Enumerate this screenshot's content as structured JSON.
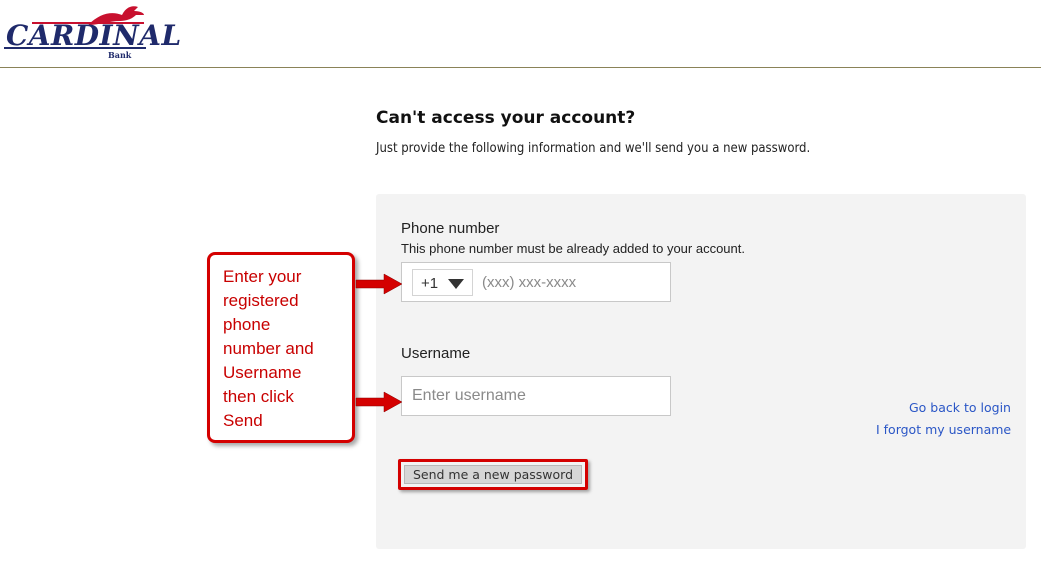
{
  "brand": {
    "name": "CARDINAL",
    "sub": "Bank",
    "colors": {
      "navy": "#1f2a6b",
      "red": "#c8102e"
    }
  },
  "page": {
    "title": "Can't access your account?",
    "subtitle": "Just provide the following information and we'll send you a new password."
  },
  "form": {
    "phone_label": "Phone number",
    "phone_help": "This phone number must be already added to your account.",
    "country_code": "+1",
    "phone_placeholder": "(xxx) xxx-xxxx",
    "username_label": "Username",
    "username_placeholder": "Enter username",
    "send_label": "Send me a new password"
  },
  "links": {
    "back_to_login": "Go back to login",
    "forgot_username": "I forgot my username",
    "color": "#2a56c6"
  },
  "callout": {
    "text": "Enter your\nregistered\nphone\nnumber and\nUsername\nthen click\nSend",
    "color": "#d40000"
  },
  "icons": {
    "dropdown": "caret-down-icon",
    "logo_bird": "cardinal-bird-icon"
  }
}
